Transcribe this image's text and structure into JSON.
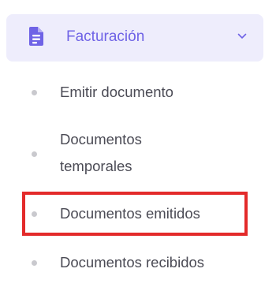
{
  "menu": {
    "section_label": "Facturación",
    "section_icon": "document-icon",
    "expand_icon": "chevron-down-icon",
    "items": [
      {
        "label": "Emitir documento"
      },
      {
        "label": "Documentos temporales"
      },
      {
        "label": "Documentos emitidos"
      },
      {
        "label": "Documentos recibidos"
      }
    ],
    "highlighted_item": "Documentos emitidos"
  },
  "colors": {
    "accent": "#6f63e6",
    "header_bg": "#eeedfc",
    "text": "#4b4b55",
    "bullet": "#c9c9ce",
    "highlight_border": "#e32a2a"
  }
}
